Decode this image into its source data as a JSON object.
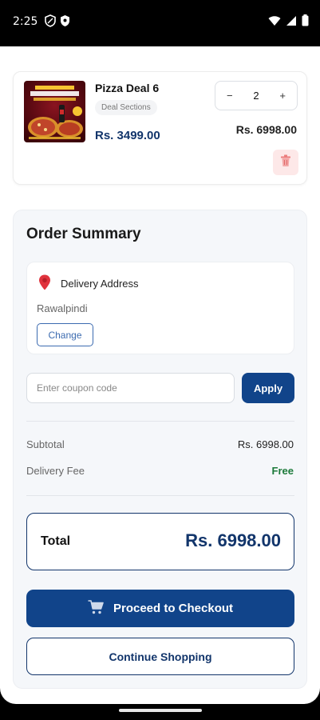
{
  "status_bar": {
    "time": "2:25"
  },
  "cart_item": {
    "name": "Pizza Deal 6",
    "category": "Deal Sections",
    "price": "Rs. 3499.00",
    "quantity": "2",
    "decrease_symbol": "−",
    "increase_symbol": "+",
    "line_total": "Rs. 6998.00",
    "image_icon": "pizza-deal-image",
    "delete_icon": "trash-icon"
  },
  "order_summary": {
    "title": "Order Summary",
    "delivery": {
      "label": "Delivery Address",
      "city": "Rawalpindi",
      "change_label": "Change",
      "icon": "location-pin-icon"
    },
    "coupon": {
      "placeholder": "Enter coupon code",
      "value": "",
      "apply_label": "Apply"
    },
    "subtotal_label": "Subtotal",
    "subtotal_value": "Rs. 6998.00",
    "delivery_fee_label": "Delivery Fee",
    "delivery_fee_value": "Free",
    "total_label": "Total",
    "total_value": "Rs. 6998.00",
    "checkout_label": "Proceed to Checkout",
    "checkout_icon": "cart-icon",
    "continue_label": "Continue Shopping"
  },
  "colors": {
    "primary": "#11448a",
    "price": "#12356b",
    "free": "#1c7a3a",
    "delete_bg": "#fde8e8"
  }
}
